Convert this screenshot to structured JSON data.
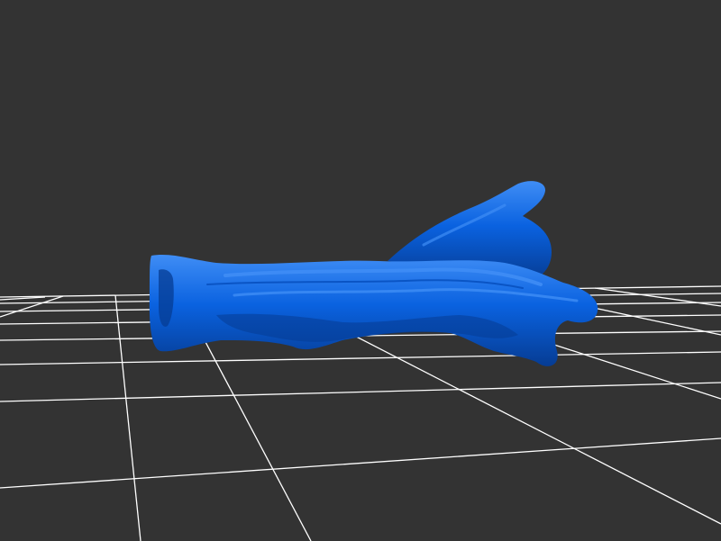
{
  "viewer": {
    "background_color": "#333333",
    "grid_color": "#ffffff",
    "model_color": "#0a62e0",
    "model_shadow_color": "#063c93",
    "model_highlight_color": "#3f8df5",
    "grid_visible": true,
    "model_name": "blue-branching-mesh"
  }
}
